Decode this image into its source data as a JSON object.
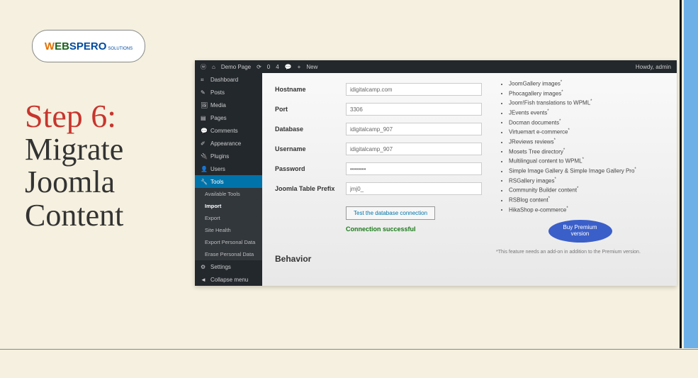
{
  "logo": {
    "part1": "W",
    "part2": "EB",
    "part3": "SPERO",
    "sub": "SOLUTIONS"
  },
  "title": {
    "step": "Step 6:",
    "line1": "Migrate",
    "line2": "Joomla",
    "line3": "Content"
  },
  "adminBar": {
    "site": "Demo Page",
    "updates": "0",
    "comments": "4",
    "new": "New",
    "howdy": "Howdy, admin"
  },
  "sidebar": {
    "items": [
      {
        "label": "Dashboard",
        "icon": "dashboard"
      },
      {
        "label": "Posts",
        "icon": "pin"
      },
      {
        "label": "Media",
        "icon": "media"
      },
      {
        "label": "Pages",
        "icon": "page"
      },
      {
        "label": "Comments",
        "icon": "comment"
      },
      {
        "label": "Appearance",
        "icon": "brush"
      },
      {
        "label": "Plugins",
        "icon": "plug"
      },
      {
        "label": "Users",
        "icon": "user"
      },
      {
        "label": "Tools",
        "icon": "wrench",
        "active": true
      },
      {
        "label": "Settings",
        "icon": "gear"
      }
    ],
    "subItems": [
      {
        "label": "Available Tools"
      },
      {
        "label": "Import",
        "active": true
      },
      {
        "label": "Export"
      },
      {
        "label": "Site Health"
      },
      {
        "label": "Export Personal Data"
      },
      {
        "label": "Erase Personal Data"
      }
    ],
    "collapse": "Collapse menu"
  },
  "form": {
    "hostname": {
      "label": "Hostname",
      "value": "idigitalcamp.com"
    },
    "port": {
      "label": "Port",
      "value": "3306"
    },
    "database": {
      "label": "Database",
      "value": "idigitalcamp_907"
    },
    "username": {
      "label": "Username",
      "value": "idigitalcamp_907"
    },
    "password": {
      "label": "Password",
      "value": "••••••••"
    },
    "prefix": {
      "label": "Joomla Table Prefix",
      "value": "jmj0_"
    },
    "testBtn": "Test the database connection",
    "success": "Connection successful",
    "behavior": "Behavior"
  },
  "features": [
    "JoomGallery images",
    "Phocagallery images",
    "Joom!Fish translations to WPML",
    "JEvents events",
    "Docman documents",
    "Virtuemart e-commerce",
    "JReviews reviews",
    "Mosets Tree directory",
    "Multilingual content to WPML",
    "Simple Image Gallery & Simple Image Gallery Pro",
    "RSGallery images",
    "Community Builder content",
    "RSBlog content",
    "HikaShop e-commerce"
  ],
  "buyBtn": {
    "line1": "Buy Premium",
    "line2": "version"
  },
  "footnote": "*This feature needs an add-on in addition to the Premium version."
}
